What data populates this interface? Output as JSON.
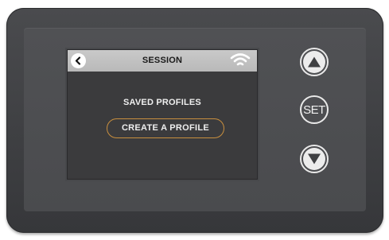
{
  "screen": {
    "title": "SESSION",
    "back_icon": "chevron-left-icon",
    "status_icon": "wifi-icon",
    "menu_label": "SAVED PROFILES",
    "action_button_label": "CREATE  A PROFILE"
  },
  "hardware_buttons": {
    "up_icon": "triangle-up-icon",
    "set_label": "SET",
    "down_icon": "triangle-down-icon"
  },
  "colors": {
    "housing": "#404144",
    "screen_bg": "#3b3b3d",
    "titlebar": "#c2c2c2",
    "accent": "#c98f3e",
    "text": "#efefef"
  }
}
